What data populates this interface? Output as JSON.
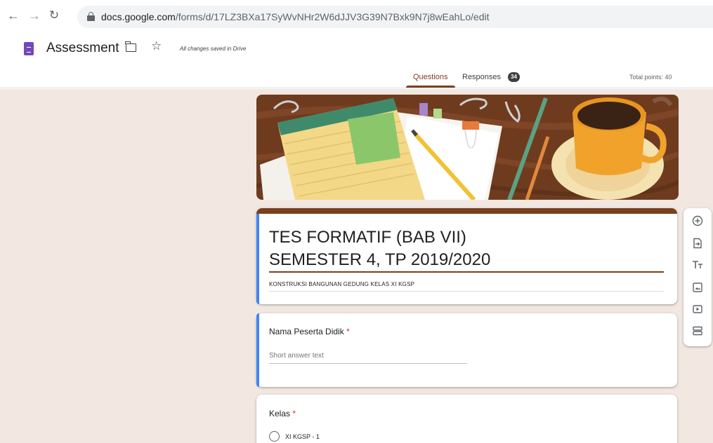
{
  "browser": {
    "url_domain": "docs.google.com",
    "url_path": "/forms/d/17LZ3BXa17SyWvNHr2W6dJJV3G39N7Bxk9N7j8wEahLo/edit"
  },
  "header": {
    "doc_title": "Assessment",
    "save_status": "All changes saved in Drive",
    "tabs": [
      {
        "label": "Questions",
        "active": true
      },
      {
        "label": "Responses",
        "badge": "34"
      }
    ],
    "total_points": "Total points: 40"
  },
  "form": {
    "title_line1": "TES FORMATIF (BAB VII)",
    "title_line2": "SEMESTER 4, TP 2019/2020",
    "description": "KONSTRUKSI BANGUNAN GEDUNG KELAS XI KGSP",
    "theme_color": "#7b3f1e"
  },
  "questions": [
    {
      "title": "Nama Peserta Didik",
      "required": "*",
      "placeholder": "Short answer text"
    },
    {
      "title": "Kelas",
      "required": "*",
      "options": [
        "XI KGSP - 1"
      ]
    }
  ],
  "toolbar": {
    "icons": [
      "add-question-icon",
      "import-questions-icon",
      "add-title-icon",
      "add-image-icon",
      "add-video-icon",
      "add-section-icon"
    ]
  }
}
